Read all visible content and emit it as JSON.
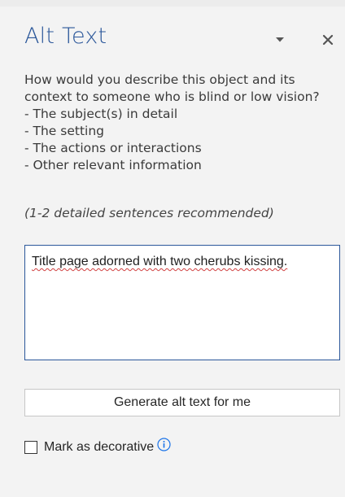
{
  "pane": {
    "title": "Alt Text",
    "options_icon": "chevron-down-icon",
    "close_icon": "close-icon",
    "description": {
      "intro": "How would you describe this object and its context to someone who is blind or low vision?",
      "items": [
        "- The subject(s) in detail",
        "- The setting",
        "- The actions or interactions",
        "- Other relevant information"
      ]
    },
    "hint": "(1-2 detailed sentences recommended)",
    "alt_text_value": "Title page adorned with two cherubs kissing.",
    "generate_button_label": "Generate alt text for me",
    "decorative_checkbox": {
      "label": "Mark as decorative",
      "checked": false,
      "info_icon": "info-icon"
    }
  },
  "colors": {
    "accent": "#2b579a",
    "pane_background": "#f3f3f3",
    "info_icon": "#1a73e8",
    "spellcheck_underline": "#d04040"
  }
}
